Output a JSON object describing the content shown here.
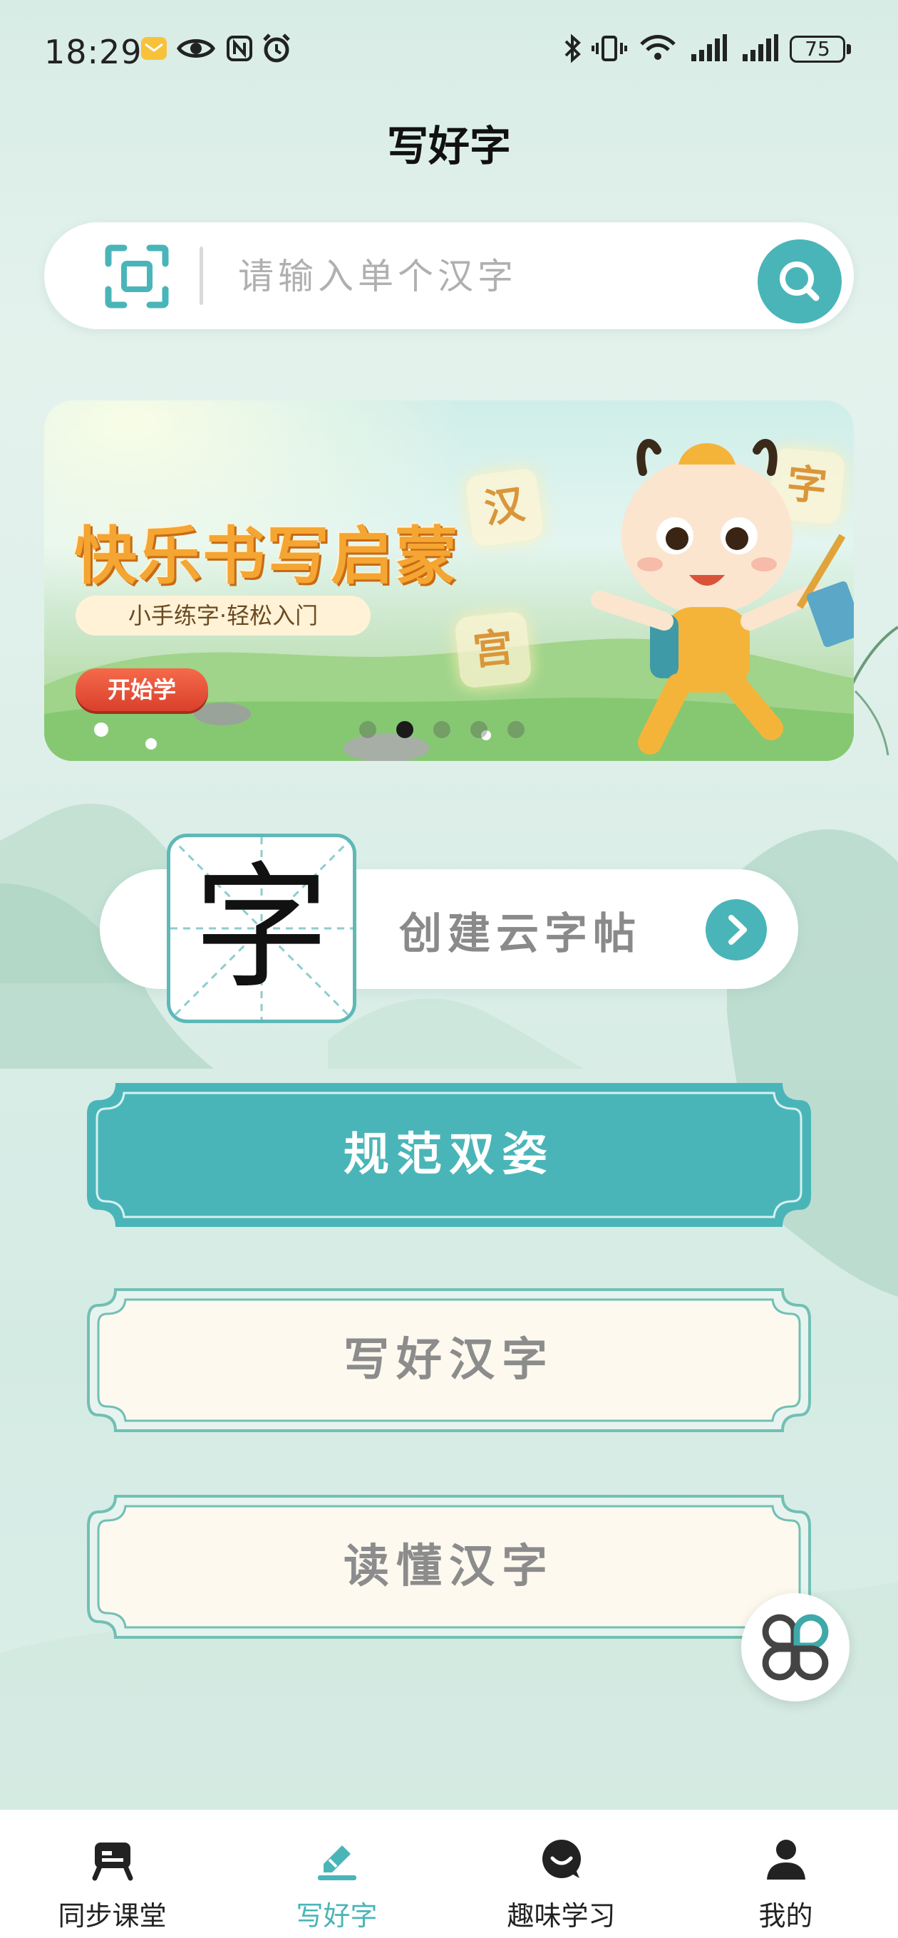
{
  "status_bar": {
    "time": "18:29",
    "battery": "75"
  },
  "header": {
    "title": "写好字"
  },
  "search": {
    "placeholder": "请输入单个汉字"
  },
  "banner": {
    "title": "快乐书写启蒙",
    "subtitle": "小手练字·轻松入门",
    "start_label": "开始学",
    "tiles": [
      "汉",
      "字",
      "宫"
    ],
    "slide_count": 5,
    "active_slide": 2
  },
  "create_card": {
    "sample_char": "字",
    "label": "创建云字帖"
  },
  "menu": {
    "posture": "规范双姿",
    "write": "写好汉字",
    "read": "读懂汉字"
  },
  "tab_bar": {
    "items": [
      {
        "label": "同步课堂",
        "icon": "classroom-icon"
      },
      {
        "label": "写好字",
        "icon": "pen-icon"
      },
      {
        "label": "趣味学习",
        "icon": "chat-icon"
      },
      {
        "label": "我的",
        "icon": "profile-icon"
      }
    ],
    "active_index": 1
  },
  "colors": {
    "accent": "#4ab5b8",
    "cream": "#fdf9ef",
    "banner_title": "#f4a532"
  }
}
